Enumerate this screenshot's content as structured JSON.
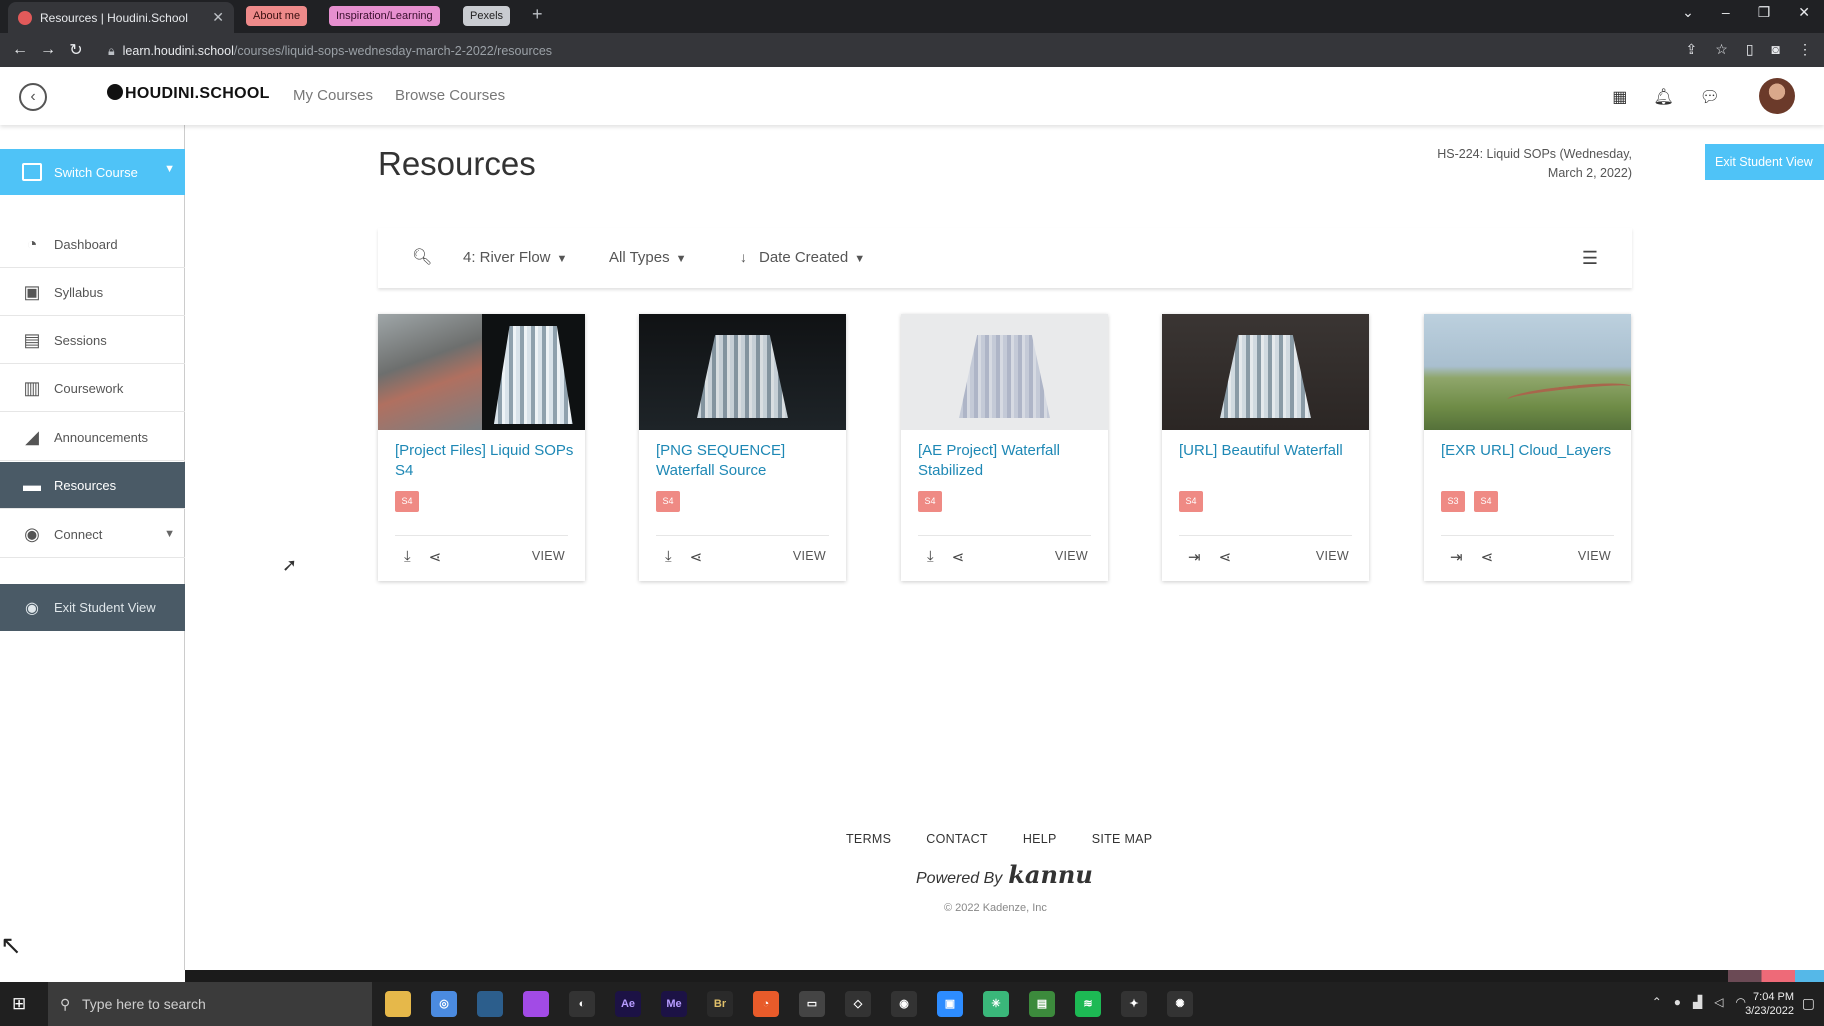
{
  "browser": {
    "active_tab": "Resources | Houdini.School",
    "tab_groups": [
      "About me",
      "Inspiration/Learning",
      "Pexels"
    ],
    "url_host": "learn.houdini.school",
    "url_path": "/courses/liquid-sops-wednesday-march-2-2022/resources"
  },
  "header": {
    "logo": "HOUDINI.SCHOOL",
    "nav": [
      "My Courses",
      "Browse Courses"
    ]
  },
  "sidebar": {
    "switch_course": "Switch Course",
    "items": [
      {
        "label": "Dashboard",
        "icon": "gauge-icon"
      },
      {
        "label": "Syllabus",
        "icon": "book-icon"
      },
      {
        "label": "Sessions",
        "icon": "presentation-icon"
      },
      {
        "label": "Coursework",
        "icon": "clipboard-icon"
      },
      {
        "label": "Announcements",
        "icon": "megaphone-icon"
      },
      {
        "label": "Resources",
        "icon": "folder-icon",
        "active": true
      },
      {
        "label": "Connect",
        "icon": "eye-icon"
      }
    ],
    "exit_student_view": "Exit Student View"
  },
  "main": {
    "title": "Resources",
    "course_info_line1": "HS-224: Liquid SOPs (Wednesday,",
    "course_info_line2": "March 2, 2022)",
    "exit_button": "Exit Student View",
    "filters": {
      "river_flow": "4: River Flow",
      "types": "All Types",
      "sort": "Date Created"
    },
    "cards": [
      {
        "title": "[Project Files] Liquid SOPs S4",
        "tags": [
          "S4"
        ],
        "action": "download",
        "view": "VIEW"
      },
      {
        "title": "[PNG SEQUENCE] Waterfall Source",
        "tags": [
          "S4"
        ],
        "action": "download",
        "view": "VIEW"
      },
      {
        "title": "[AE Project] Waterfall Stabilized",
        "tags": [
          "S4"
        ],
        "action": "download",
        "view": "VIEW"
      },
      {
        "title": "[URL] Beautiful Waterfall",
        "tags": [
          "S4"
        ],
        "action": "open-link",
        "view": "VIEW"
      },
      {
        "title": "[EXR URL] Cloud_Layers",
        "tags": [
          "S3",
          "S4"
        ],
        "action": "open-link",
        "view": "VIEW"
      }
    ]
  },
  "footer": {
    "links": [
      "TERMS",
      "CONTACT",
      "HELP",
      "SITE MAP"
    ],
    "powered_by": "Powered By",
    "brand": "kannu",
    "copyright": "© 2022 Kadenze, Inc"
  },
  "taskbar": {
    "search_placeholder": "Type here to search",
    "time": "7:04 PM",
    "date": "3/23/2022"
  },
  "colors": {
    "accent": "#4fc3f7",
    "sidebar_active": "#4a5a66",
    "tag": "#ef8a84",
    "link": "#1e88b5"
  }
}
